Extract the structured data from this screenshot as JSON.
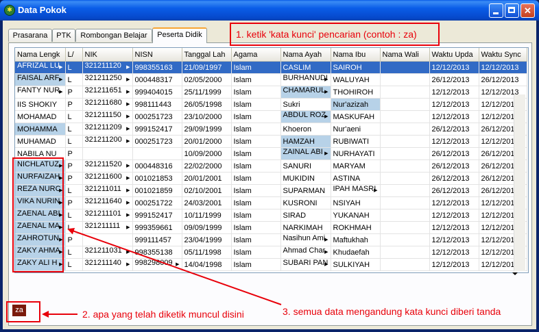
{
  "window": {
    "title": "Data Pokok",
    "min": "_",
    "max": "□",
    "close": "✕"
  },
  "tabs": [
    "Prasarana",
    "PTK",
    "Rombongan Belajar",
    "Peserta Didik"
  ],
  "columns": [
    "Nama Lengk",
    "L/",
    "NIK",
    "NISN",
    "Tanggal Lah",
    "Agama",
    "Nama Ayah",
    "Nama Ibu",
    "Nama Wali",
    "Waktu Upda",
    "Waktu Sync"
  ],
  "rows": [
    [
      "AFRIZAL LU",
      "L",
      "321211120",
      "998355163",
      "21/09/1997",
      "Islam",
      "CASLIM",
      "SAIROH",
      "",
      "12/12/2013",
      "12/12/2013"
    ],
    [
      "FAISAL ARF",
      "L",
      "321211250",
      "000448317",
      "02/05/2000",
      "Islam",
      "BURHANUDI",
      "WALUYAH",
      "",
      "26/12/2013",
      "26/12/2013"
    ],
    [
      "FANTY NUR",
      "P",
      "321211651",
      "999404015",
      "25/11/1999",
      "Islam",
      "CHAMARUL",
      "THOHIROH",
      "",
      "12/12/2013",
      "12/12/2013"
    ],
    [
      "IIS SHOKIY",
      "P",
      "321211680",
      "998111443",
      "26/05/1998",
      "Islam",
      "Sukri",
      "Nur'azizah",
      "",
      "12/12/2013",
      "12/12/2013"
    ],
    [
      "MOHAMAD",
      "L",
      "321211150",
      "000251723",
      "23/10/2000",
      "Islam",
      "ABDUL ROZ",
      "MASKUFAH",
      "",
      "12/12/2013",
      "12/12/2013"
    ],
    [
      "MOHAMMA",
      "L",
      "321211209",
      "999152417",
      "29/09/1999",
      "Islam",
      "Khoeron",
      "Nur'aeni",
      "",
      "26/12/2013",
      "26/12/2013"
    ],
    [
      "MUHAMAD",
      "L",
      "321211200",
      "000251723",
      "20/01/2000",
      "Islam",
      "HAMZAH",
      "RUBIWATI",
      "",
      "12/12/2013",
      "12/12/2013"
    ],
    [
      "NABILA NU",
      "P",
      "",
      "",
      "10/09/2000",
      "Islam",
      "ZAINAL ABI",
      "NURHAYATI",
      "",
      "26/12/2013",
      "26/12/2013"
    ],
    [
      "NICHLATUZ",
      "P",
      "321211520",
      "000448316",
      "22/02/2000",
      "Islam",
      "SANURI",
      "MARYAM",
      "",
      "26/12/2013",
      "26/12/2013"
    ],
    [
      "NURFAIZAH",
      "P",
      "321211600",
      "001021853",
      "20/01/2001",
      "Islam",
      "MUKIDIN",
      "ASTINA",
      "",
      "26/12/2013",
      "26/12/2013"
    ],
    [
      "REZA NURC",
      "L",
      "321211011",
      "001021859",
      "02/10/2001",
      "Islam",
      "SUPARMAN",
      "IPAH MASRI",
      "",
      "26/12/2013",
      "26/12/2013"
    ],
    [
      "VIKA NURIN",
      "P",
      "321211640",
      "000251722",
      "24/03/2001",
      "Islam",
      "KUSRONI",
      "NSIYAH",
      "",
      "12/12/2013",
      "12/12/2013"
    ],
    [
      "ZAENAL ABI",
      "L",
      "321211101",
      "999152417",
      "10/11/1999",
      "Islam",
      "SIRAD",
      "YUKANAH",
      "",
      "12/12/2013",
      "12/12/2013"
    ],
    [
      "ZAENAL MA",
      "L",
      "321211111",
      "999359661",
      "09/09/1999",
      "Islam",
      "NARKIMAH",
      "ROKHMAH",
      "",
      "12/12/2013",
      "12/12/2013"
    ],
    [
      "ZAHROTUN",
      "P",
      "",
      "999111457",
      "23/04/1999",
      "Islam",
      "Nasihun Ami",
      "Maftukhah",
      "",
      "12/12/2013",
      "12/12/2013"
    ],
    [
      "ZAKY AHMA",
      "L",
      "321211031",
      "998355138",
      "05/11/1998",
      "Islam",
      "Ahmad Char",
      "Khudaefah",
      "",
      "12/12/2013",
      "12/12/2013"
    ],
    [
      "ZAKY ALI H",
      "L",
      "321211140",
      "998298009",
      "14/04/1998",
      "Islam",
      "SUBARI PAN",
      "SULKIYAH",
      "",
      "12/12/2013",
      "12/12/2013"
    ]
  ],
  "search": {
    "value": "za"
  },
  "annotations": {
    "a1": "1. ketik 'kata kunci' pencarian (contoh : za)",
    "a2": "2. apa yang telah diketik muncul disini",
    "a3": "3. semua data mengandung kata kunci diberi tanda"
  },
  "colors": {
    "accent_red": "#e8000a",
    "selection": "#316ac5",
    "highlight": "#b7d2e8"
  }
}
